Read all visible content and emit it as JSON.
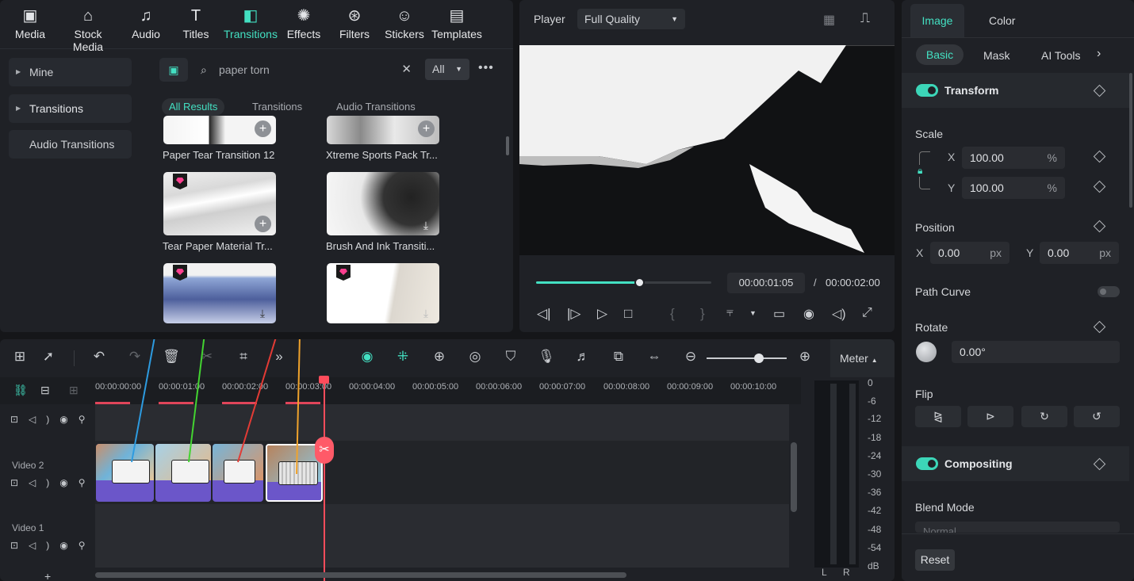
{
  "toolbar": {
    "items": [
      {
        "label": "Media",
        "icon": "media-icon"
      },
      {
        "label": "Stock Media",
        "icon": "stock-media-icon"
      },
      {
        "label": "Audio",
        "icon": "audio-icon"
      },
      {
        "label": "Titles",
        "icon": "titles-icon"
      },
      {
        "label": "Transitions",
        "icon": "transitions-icon",
        "active": true
      },
      {
        "label": "Effects",
        "icon": "effects-icon"
      },
      {
        "label": "Filters",
        "icon": "filters-icon"
      },
      {
        "label": "Stickers",
        "icon": "stickers-icon"
      },
      {
        "label": "Templates",
        "icon": "templates-icon"
      }
    ]
  },
  "categories": [
    "Mine",
    "Transitions",
    "Audio Transitions"
  ],
  "search": {
    "value": "paper torn",
    "scope": "All"
  },
  "filter_tabs": [
    "All Results",
    "Transitions",
    "Audio Transitions"
  ],
  "thumbnails": [
    {
      "label": "Paper Tear Transition 12"
    },
    {
      "label": "Xtreme Sports Pack Tr..."
    },
    {
      "label": "Tear Paper Material Tr..."
    },
    {
      "label": "Brush And Ink Transiti..."
    }
  ],
  "player": {
    "label": "Player",
    "quality": "Full Quality",
    "current_time": "00:00:01:05",
    "separator": "/",
    "total_time": "00:00:02:00",
    "progress": 0.59
  },
  "inspector": {
    "tabs": [
      "Image",
      "Color"
    ],
    "subtabs": [
      "Basic",
      "Mask",
      "AI Tools"
    ],
    "transform_label": "Transform",
    "scale_label": "Scale",
    "scale_x_axis": "X",
    "scale_y_axis": "Y",
    "scale_x": "100.00",
    "scale_y": "100.00",
    "scale_unit": "%",
    "position_label": "Position",
    "pos_x_axis": "X",
    "pos_y_axis": "Y",
    "pos_x": "0.00",
    "pos_y": "0.00",
    "pos_unit": "px",
    "path_curve_label": "Path Curve",
    "rotate_label": "Rotate",
    "rotate_value": "0.00°",
    "flip_label": "Flip",
    "compositing_label": "Compositing",
    "blend_mode_label": "Blend Mode",
    "blend_mode_value": "Normal",
    "reset_label": "Reset"
  },
  "timeline": {
    "ruler": [
      "00:00:00:00",
      "00:00:01:00",
      "00:00:02:00",
      "00:00:03:00",
      "00:00:04:00",
      "00:00:05:00",
      "00:00:06:00",
      "00:00:07:00",
      "00:00:08:00",
      "00:00:09:00",
      "00:00:10:00"
    ],
    "tracks": [
      "Video 2",
      "Video 1"
    ],
    "meter_label": "Meter",
    "meter_scale": [
      "0",
      "-6",
      "-12",
      "-18",
      "-24",
      "-30",
      "-36",
      "-42",
      "-48",
      "-54",
      "dB"
    ],
    "meter_channels": [
      "L",
      "R"
    ]
  }
}
